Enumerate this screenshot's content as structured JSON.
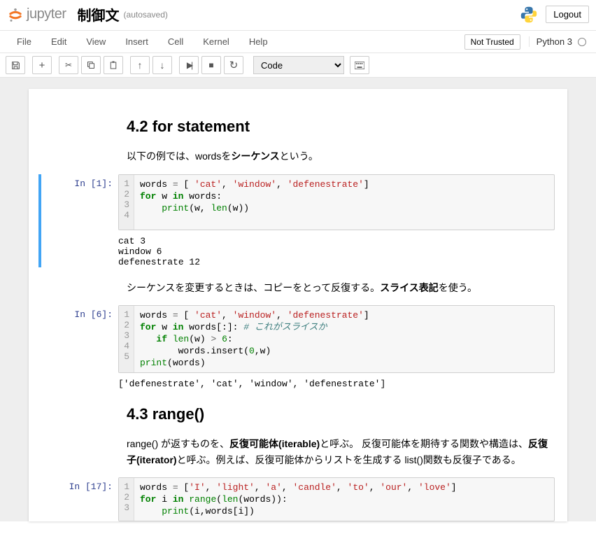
{
  "header": {
    "logo_text": "jupyter",
    "title": "制御文",
    "autosave": "(autosaved)",
    "logout": "Logout"
  },
  "menubar": {
    "items": [
      "File",
      "Edit",
      "View",
      "Insert",
      "Cell",
      "Kernel",
      "Help"
    ],
    "trust": "Not Trusted",
    "kernel": "Python 3"
  },
  "toolbar": {
    "celltype": "Code"
  },
  "content": {
    "h1": "4.2 for statement",
    "p1_pre": "以下の例では、wordsを",
    "p1_b": "シーケンス",
    "p1_post": "という。",
    "cell1": {
      "prompt": "In [1]:",
      "gutter": "1\n2\n3\n4",
      "output": "cat 3\nwindow 6\ndefenestrate 12"
    },
    "p2_pre": "シーケンスを変更するときは、コピーをとって反復する。",
    "p2_b": "スライス表記",
    "p2_post": "を使う。",
    "cell2": {
      "prompt": "In [6]:",
      "gutter": "1\n2\n3\n4\n5",
      "output": "['defenestrate', 'cat', 'window', 'defenestrate']"
    },
    "h2": "4.3 range()",
    "p3_pre": "range() が返すものを、",
    "p3_b1": "反復可能体(iterable)",
    "p3_mid": "と呼ぶ。 反復可能体を期待する関数や構造は、",
    "p3_b2": "反復子(iterator)",
    "p3_post": "と呼ぶ。例えば、反復可能体からリストを生成する list()関数も反復子である。",
    "cell3": {
      "prompt": "In [17]:",
      "gutter": "1\n2\n3"
    }
  }
}
